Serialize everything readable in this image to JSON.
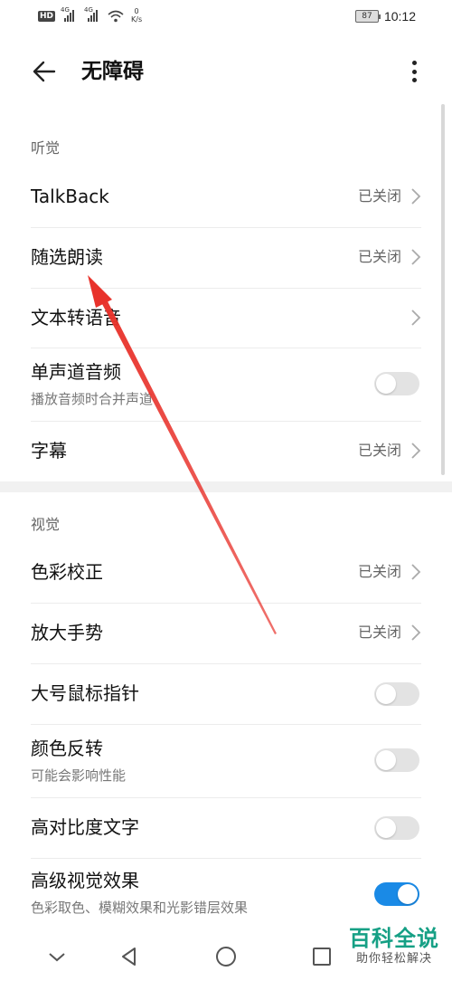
{
  "status_bar": {
    "hd": "HD",
    "network_1": "4G",
    "network_2": "4G",
    "speed_value": "0",
    "speed_unit": "K/s",
    "battery": "87",
    "time": "10:12"
  },
  "toolbar": {
    "title": "无障碍"
  },
  "sections": {
    "hearing": {
      "header": "听觉",
      "talkback": {
        "label": "TalkBack",
        "value": "已关闭"
      },
      "select_to_speak": {
        "label": "随选朗读",
        "value": "已关闭"
      },
      "text_to_speech": {
        "label": "文本转语音"
      },
      "mono_audio": {
        "label": "单声道音频",
        "sub": "播放音频时合并声道",
        "toggle_on": false
      },
      "captions": {
        "label": "字幕",
        "value": "已关闭"
      }
    },
    "vision": {
      "header": "视觉",
      "color_correction": {
        "label": "色彩校正",
        "value": "已关闭"
      },
      "magnification": {
        "label": "放大手势",
        "value": "已关闭"
      },
      "large_pointer": {
        "label": "大号鼠标指针",
        "toggle_on": false
      },
      "color_inversion": {
        "label": "颜色反转",
        "sub": "可能会影响性能",
        "toggle_on": false
      },
      "high_contrast_text": {
        "label": "高对比度文字",
        "toggle_on": false
      },
      "advanced_visual": {
        "label": "高级视觉效果",
        "sub": "色彩取色、模糊效果和光影错层效果",
        "toggle_on": true
      }
    }
  },
  "colors": {
    "accent": "#1a8ae6",
    "annotation_arrow": "#e8322b",
    "watermark": "#16a085"
  },
  "watermark": {
    "title": "百科全说",
    "subtitle": "助你轻松解决"
  },
  "icons": {
    "back": "arrow-left-icon",
    "more": "more-vertical-icon",
    "chevron": "chevron-right-icon",
    "nav_back": "triangle-back-icon",
    "nav_home": "circle-home-icon",
    "nav_recent": "square-recents-icon",
    "nav_down": "chevron-down-icon"
  }
}
